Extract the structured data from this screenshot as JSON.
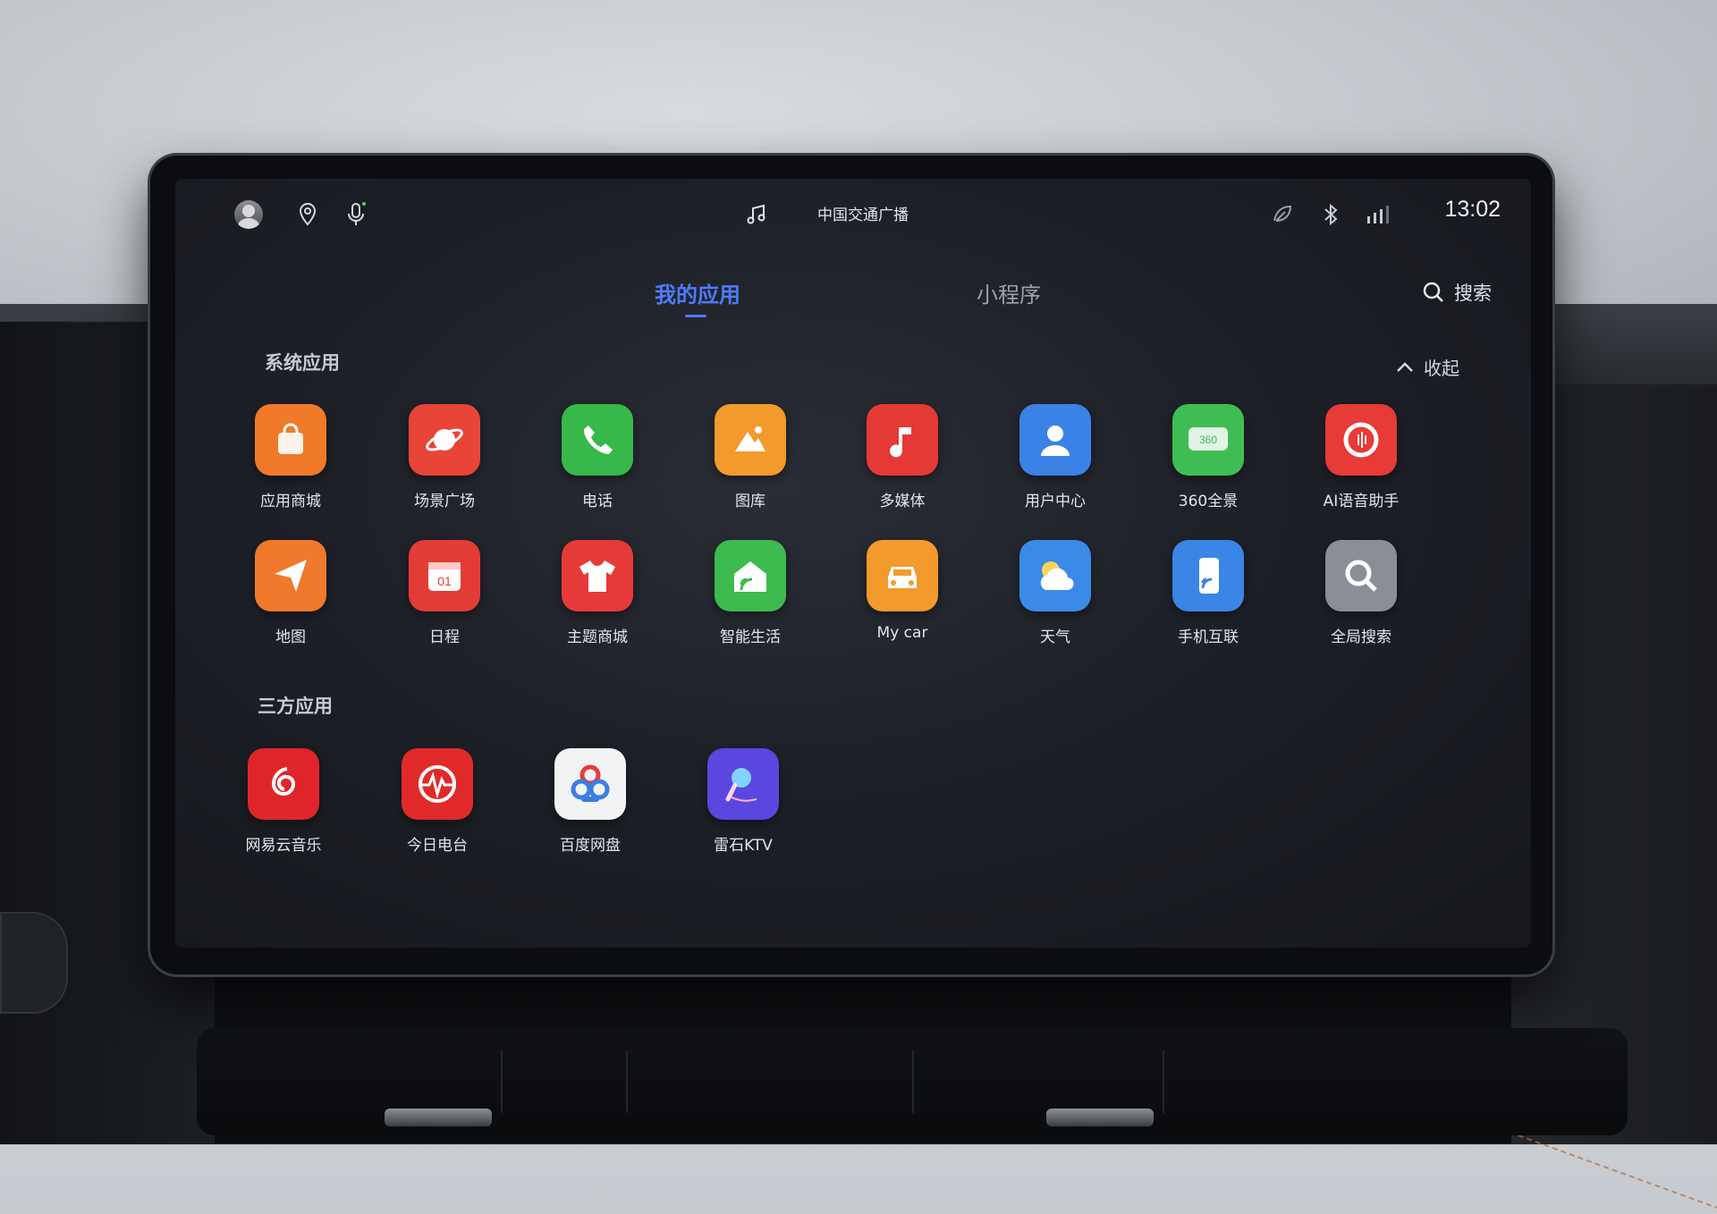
{
  "status_bar": {
    "media_icon": "music-note-icon",
    "station": "中国交通广播",
    "time": "13:02"
  },
  "tabs": [
    {
      "label": "我的应用",
      "active": true
    },
    {
      "label": "小程序",
      "active": false
    }
  ],
  "search_label": "搜索",
  "collapse_label": "收起",
  "sections": {
    "system": {
      "title": "系统应用",
      "apps": [
        {
          "label": "应用商城",
          "icon": "shopping-bag-icon",
          "color": "#f07a2a"
        },
        {
          "label": "场景广场",
          "icon": "planet-icon",
          "color": "#e84438"
        },
        {
          "label": "电话",
          "icon": "phone-icon",
          "color": "#36b84a"
        },
        {
          "label": "图库",
          "icon": "gallery-icon",
          "color": "#f29a2c"
        },
        {
          "label": "多媒体",
          "icon": "music-note-icon",
          "color": "#e53935"
        },
        {
          "label": "用户中心",
          "icon": "user-icon",
          "color": "#3b82e6"
        },
        {
          "label": "360全景",
          "icon": "360-camera-icon",
          "color": "#3fbd54"
        },
        {
          "label": "AI语音助手",
          "icon": "voice-assistant-icon",
          "color": "#e63b36"
        },
        {
          "label": "地图",
          "icon": "navigation-arrow-icon",
          "color": "#f0792b"
        },
        {
          "label": "日程",
          "icon": "calendar-icon",
          "color": "#e33c36"
        },
        {
          "label": "主题商城",
          "icon": "tshirt-icon",
          "color": "#e63a38"
        },
        {
          "label": "智能生活",
          "icon": "smart-home-icon",
          "color": "#3dbb4e"
        },
        {
          "label": "My car",
          "icon": "car-icon",
          "color": "#f29a2b"
        },
        {
          "label": "天气",
          "icon": "weather-icon",
          "color": "#3c8ae8"
        },
        {
          "label": "手机互联",
          "icon": "phone-link-icon",
          "color": "#3b85e6"
        },
        {
          "label": "全局搜索",
          "icon": "search-icon",
          "color": "#8a8e96"
        }
      ]
    },
    "third_party": {
      "title": "三方应用",
      "apps": [
        {
          "label": "网易云音乐",
          "icon": "netease-music-icon",
          "color": "#e0252a"
        },
        {
          "label": "今日电台",
          "icon": "radio-wave-icon",
          "color": "#e02a2a"
        },
        {
          "label": "百度网盘",
          "icon": "baidu-cloud-icon",
          "color": "#f2f3f5"
        },
        {
          "label": "雷石KTV",
          "icon": "microphone-icon",
          "color": "#5b46e0"
        }
      ]
    }
  }
}
